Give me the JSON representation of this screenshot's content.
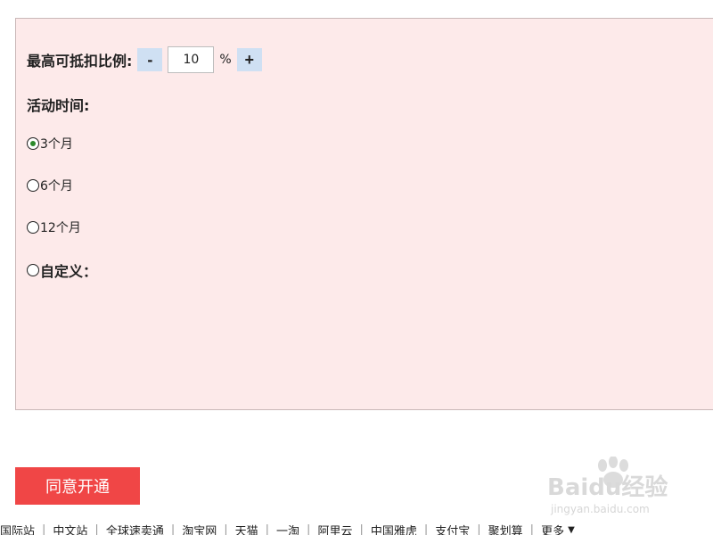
{
  "form": {
    "ratio_label": "最高可抵扣比例:",
    "decrement_label": "-",
    "increment_label": "+",
    "ratio_value": "10",
    "percent_unit": "%",
    "activity_time_label": "活动时间:",
    "duration_options": [
      {
        "label": "3个月",
        "selected": true
      },
      {
        "label": "6个月",
        "selected": false
      },
      {
        "label": "12个月",
        "selected": false
      },
      {
        "label": "自定义：",
        "selected": false
      }
    ]
  },
  "agree_button_label": "同意开通",
  "footer": {
    "links": [
      "国际站",
      "中文站",
      "全球速卖通",
      "淘宝网",
      "天猫",
      "一淘",
      "阿里云",
      "中国雅虎",
      "支付宝",
      "聚划算",
      "更多"
    ]
  },
  "watermark": {
    "brand": "Baidu经验",
    "url": "jingyan.baidu.com"
  },
  "colors": {
    "panel_background": "#fdeaea",
    "stepper_background": "#cfe0f3",
    "agree_button": "#f04646",
    "radio_selected": "#2b8a2b"
  }
}
